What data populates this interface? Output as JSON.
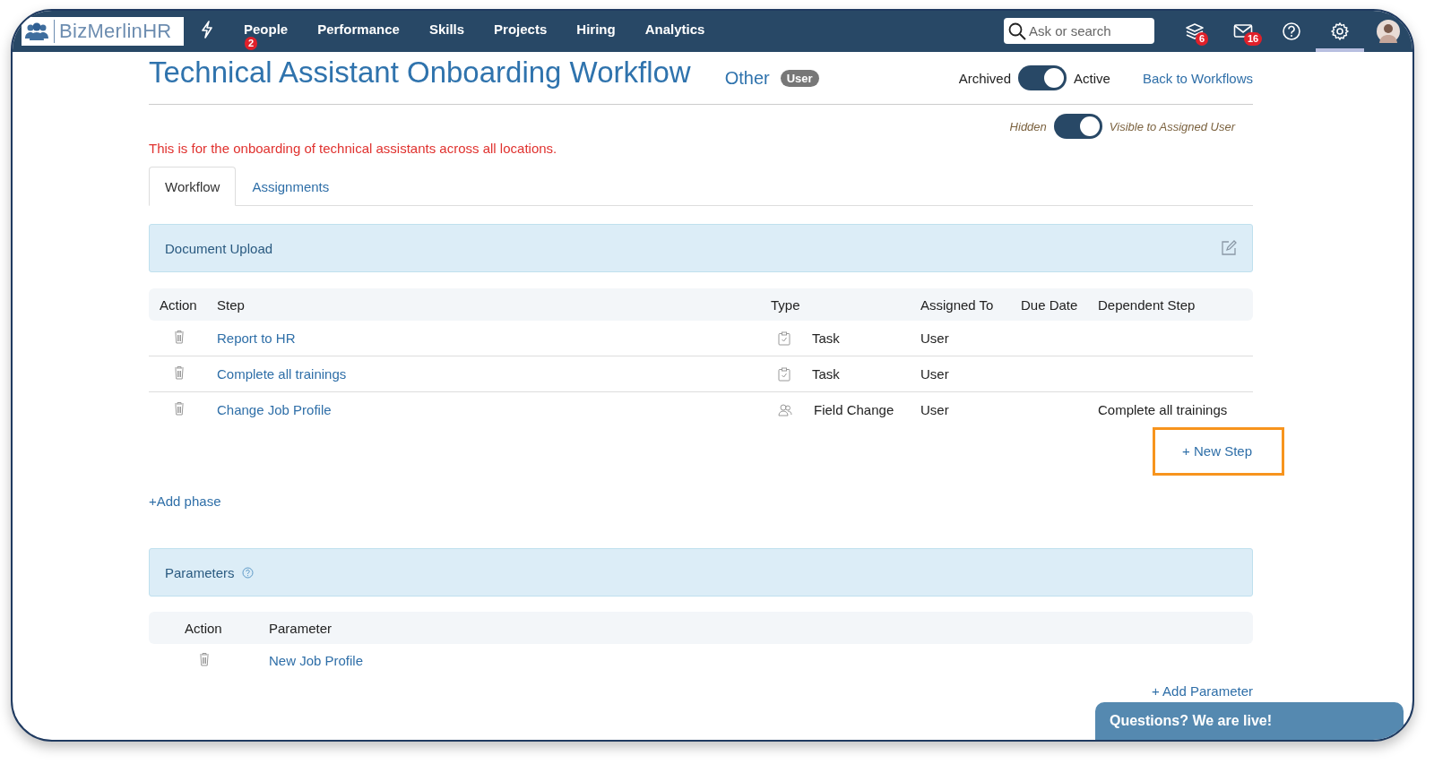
{
  "nav": {
    "logo": "BizMerlinHR",
    "items": [
      {
        "label": "People",
        "badge": "2"
      },
      {
        "label": "Performance"
      },
      {
        "label": "Skills"
      },
      {
        "label": "Projects"
      },
      {
        "label": "Hiring"
      },
      {
        "label": "Analytics"
      }
    ],
    "search": {
      "placeholder": "Ask or search"
    },
    "icons": [
      {
        "kind": "layers",
        "badge": "6",
        "selected": false
      },
      {
        "kind": "mail",
        "badge": "16",
        "selected": false
      },
      {
        "kind": "help",
        "selected": false
      },
      {
        "kind": "settings",
        "selected": true
      },
      {
        "kind": "avatar",
        "selected": false
      }
    ]
  },
  "header": {
    "title": "Technical Assistant Onboarding Workflow",
    "category": "Other",
    "badge": "User",
    "status_toggle": {
      "off_label": "Archived",
      "on_label": "Active",
      "on": true
    },
    "back_link": "Back to Workflows",
    "visibility_toggle": {
      "off_label": "Hidden",
      "on_label": "Visible to Assigned User",
      "on": true
    }
  },
  "description": "This is for the onboarding of technical assistants across all locations.",
  "tabs": [
    {
      "label": "Workflow",
      "selected": true
    },
    {
      "label": "Assignments",
      "selected": false
    }
  ],
  "phase": {
    "title": "Document Upload",
    "columns": [
      "Action",
      "Step",
      "Type",
      "Assigned To",
      "Due Date",
      "Dependent Step"
    ],
    "rows": [
      {
        "step": "Report to HR",
        "kind": "task",
        "type": "Task",
        "assigned_to": "User"
      },
      {
        "step": "Complete all trainings",
        "kind": "task",
        "type": "Task",
        "assigned_to": "User"
      },
      {
        "step": "Change Job Profile",
        "kind": "field",
        "type": "Field Change",
        "assigned_to": "User",
        "dependent_step": "Complete all trainings"
      }
    ],
    "new_step": {
      "label": "+ New Step",
      "highlighted": true
    }
  },
  "add_phase": "+Add phase",
  "parameters": {
    "title": "Parameters",
    "columns": [
      "Action",
      "Parameter"
    ],
    "rows": [
      {
        "name": "New Job Profile"
      }
    ],
    "add": "+ Add Parameter"
  },
  "chat": "Questions? We are live!"
}
